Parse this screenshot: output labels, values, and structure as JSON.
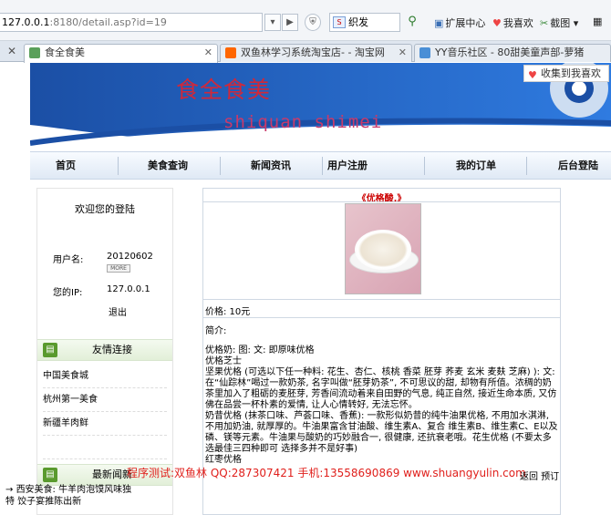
{
  "browser": {
    "url_host": "127.0.0.1",
    "url_rest": ":8180/detail.asp?id=19",
    "search_value": "织发",
    "search_engine_icon": "sogou-icon",
    "toolbar": {
      "extensions": "扩展中心",
      "favorites": "我喜欢",
      "screenshot": "截图"
    },
    "tabs": [
      {
        "label": "食全食美",
        "active": true
      },
      {
        "label": "双鱼林学习系统淘宝店- - 淘宝网",
        "active": false
      },
      {
        "label": "YY音乐社区 - 80甜美童声部-萝猪",
        "active": false
      }
    ]
  },
  "site": {
    "title": "食全食美",
    "subtitle": "shiquan shimei",
    "fav_button": "收集到我喜欢"
  },
  "menu": [
    "首页",
    "美食查询",
    "新闻资讯",
    "用户注册",
    "我的订单",
    "后台登陆"
  ],
  "sidebar": {
    "login_title": "欢迎您的登陆",
    "username_label": "用户名:",
    "username": "20120602",
    "ip_label": "您的IP:",
    "ip": "127.0.0.1",
    "logout": "退出",
    "links_title": "友情连接",
    "links": [
      "中国美食城",
      "杭州第一美食",
      "新疆羊肉鲜"
    ],
    "more": "MORE",
    "news_title": "最新闻新",
    "news_item": "西安美食: 牛羊肉泡馍风味独特 饺子宴推陈出新"
  },
  "detail": {
    "title": "《优格酸.》",
    "price_label": "价格: 10元",
    "intro_label": "简介:",
    "description": "优格奶: 图: 文: 即原味优格\n优格芝士\n坚果优格 (可选以下任一种料: 花生、杏仁、核桃  香菜  胚芽 荞麦 玄米 麦麸 芝麻) ): 文: 在“仙踪林”喝过一款奶茶, 名字叫做“胚芽奶茶”, 不可思议的甜, 却物有所值。浓稠的奶茶里加入了粗砺的麦胚芽, 芳香间流动着来自田野的气息, 纯正自然, 接近生命本质, 又仿佛在品尝一杯朴素的爱情, 让人心情转好, 无法忘怀。\n奶昔优格 (抹茶口味、芦荟口味、香蕉): 一款形似奶昔的纯牛油果优格, 不用加水淇淋, 不用加奶油, 就厚厚的。牛油果富含甘油酸、维生素A、复合 维生素B、维生素C、E以及磷、镁等元素。牛油果与酸奶的巧妙融合一, 很健康, 还抗衰老哦。花生优格 (不要太多 选最佳三四种即可 选择多并不是好事)\n红枣优格"
  },
  "watermark": "程序测试:双鱼林 QQ:287307421 手机:13558690869 www.shuangyulin.com",
  "back_links": "返回  预订"
}
